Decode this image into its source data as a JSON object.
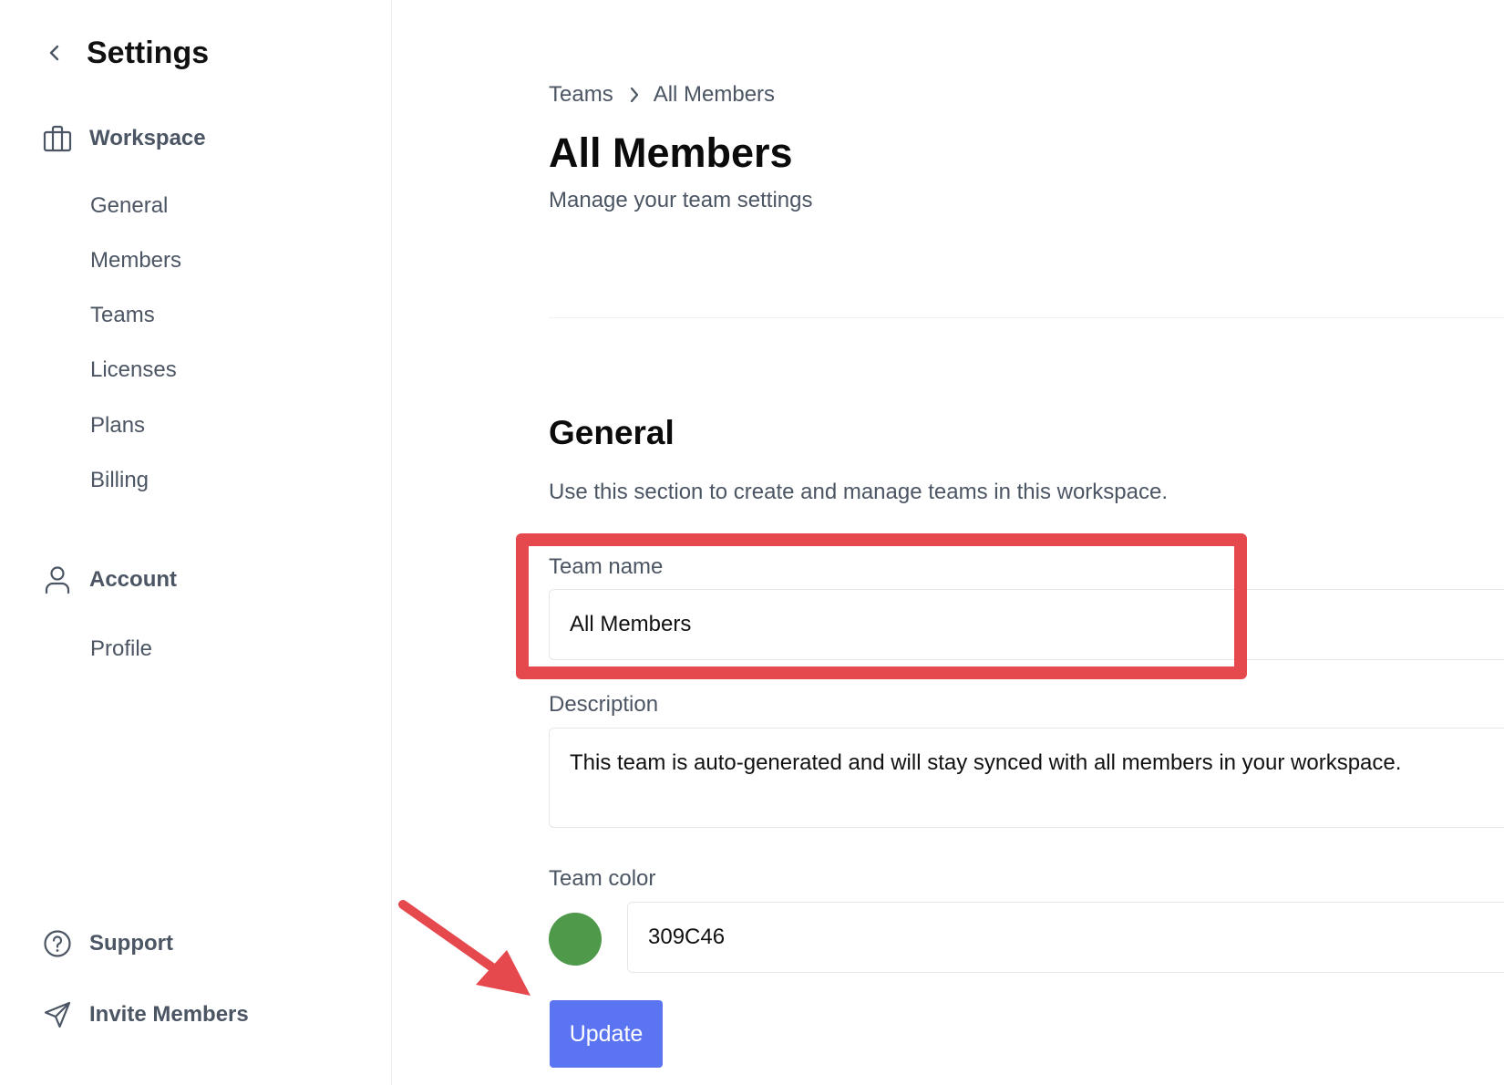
{
  "sidebar": {
    "title": "Settings",
    "workspace_section": {
      "label": "Workspace",
      "icon": "briefcase-icon",
      "items": [
        "General",
        "Members",
        "Teams",
        "Licenses",
        "Plans",
        "Billing"
      ]
    },
    "account_section": {
      "label": "Account",
      "icon": "user-icon",
      "items": [
        "Profile"
      ]
    },
    "footer": [
      {
        "label": "Support",
        "icon": "help-circle-icon"
      },
      {
        "label": "Invite Members",
        "icon": "send-icon"
      }
    ]
  },
  "main": {
    "breadcrumb": {
      "parent": "Teams",
      "current": "All Members"
    },
    "title": "All Members",
    "subtitle": "Manage your team settings",
    "section": {
      "title": "General",
      "description": "Use this section to create and manage teams in this workspace."
    },
    "form": {
      "team_name_label": "Team name",
      "team_name_value": "All Members",
      "description_label": "Description",
      "description_value": "This team is auto-generated and will stay synced with all members in your workspace.",
      "team_color_label": "Team color",
      "team_color_value": "309C46",
      "update_label": "Update"
    }
  },
  "colors": {
    "accent": "#5b74f2",
    "team_color_swatch": "#4e9a4a",
    "annotation": "#e5484d"
  }
}
